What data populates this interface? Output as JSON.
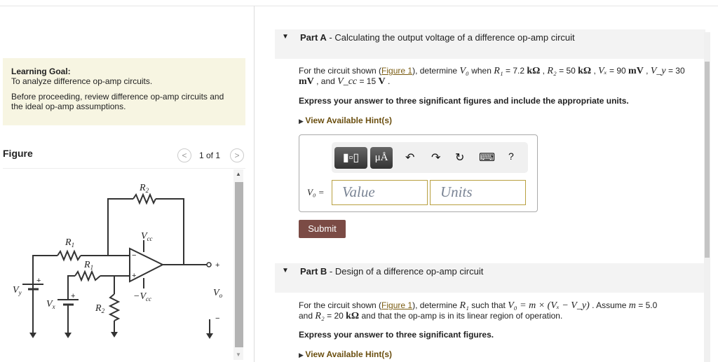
{
  "learning_goal": {
    "heading": "Learning Goal:",
    "text": "To analyze difference op-amp circuits.",
    "note": "Before proceeding, review difference op-amp circuits and the ideal op-amp assumptions."
  },
  "figure": {
    "title": "Figure",
    "pager": "1 of 1",
    "prev": "<",
    "next": ">",
    "labels": {
      "r2_top": "R",
      "r2_top_sub": "2",
      "r1_top": "R",
      "r1_top_sub": "1",
      "r1_bot": "R",
      "r1_bot_sub": "1",
      "r2_bot": "R",
      "r2_bot_sub": "2",
      "vcc": "V",
      "vcc_sub": "cc",
      "neg_vcc": "−V",
      "neg_vcc_sub": "cc",
      "vy": "V",
      "vy_sub": "y",
      "vx": "V",
      "vx_sub": "x",
      "vo": "V",
      "vo_sub": "o",
      "plus": "+",
      "minus": "−"
    }
  },
  "part_a": {
    "label": "Part A",
    "title": " - Calculating the output voltage of a difference op-amp circuit",
    "q1": "For the circuit shown (",
    "fig_link": "Figure 1",
    "q2": "), determine ",
    "v0": "V₀",
    "q3": " when ",
    "r1": "R₁",
    "r1_val": " = 7.2 ",
    "kohm": "kΩ",
    "sep": " , ",
    "r2": "R₂",
    "r2_val": " = 50 ",
    "vx": "Vₓ",
    "vx_val": " = 90 ",
    "mv": "mV",
    "vy": "V_y",
    "vy_val": " = 30 ",
    "and": " , and ",
    "vcc": "V_cc",
    "vcc_val": " = 15 ",
    "volt": "V",
    "end": " .",
    "instruction": "Express your answer to three significant figures and include the appropriate units.",
    "hints": "View Available Hint(s)",
    "toolbar": {
      "templates": "▮▫▯",
      "units": "μÅ",
      "undo": "↶",
      "redo": "↷",
      "reset": "↻",
      "keyboard": "⌨",
      "help": "?"
    },
    "answer_label": "V₀ =",
    "value_placeholder": "Value",
    "units_placeholder": "Units",
    "submit": "Submit"
  },
  "part_b": {
    "label": "Part B",
    "title": " - Design of a difference op-amp circuit",
    "q1": "For the circuit shown (",
    "fig_link": "Figure 1",
    "q2": "), determine ",
    "r1": "R₁",
    "q3": " such that ",
    "eq": "V₀ = m × (Vₓ − V_y)",
    "q4": " . Assume ",
    "m": "m",
    "m_val": " = 5.0",
    "q5": "and ",
    "r2": "R₂",
    "r2_val": " = 20 ",
    "kohm": "kΩ",
    "q6": "  and that the op-amp is in its linear region of operation.",
    "instruction": "Express your answer to three significant figures.",
    "hints": "View Available Hint(s)"
  }
}
